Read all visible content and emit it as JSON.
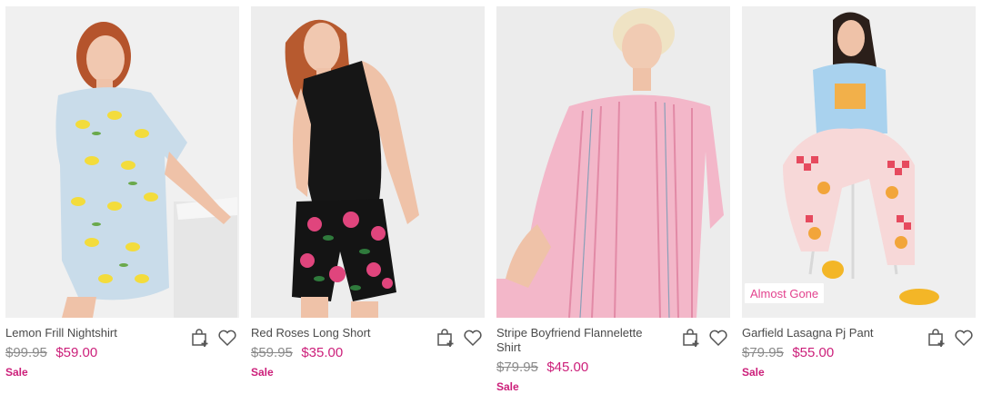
{
  "products": [
    {
      "name": "Lemon Frill Nightshirt",
      "was_price": "$99.95",
      "now_price": "$59.00",
      "tag": "Sale",
      "badge": ""
    },
    {
      "name": "Red Roses Long Short",
      "was_price": "$59.95",
      "now_price": "$35.00",
      "tag": "Sale",
      "badge": ""
    },
    {
      "name": "Stripe Boyfriend Flannelette Shirt",
      "was_price": "$79.95",
      "now_price": "$45.00",
      "tag": "Sale",
      "badge": ""
    },
    {
      "name": "Garfield Lasagna Pj Pant",
      "was_price": "$79.95",
      "now_price": "$55.00",
      "tag": "Sale",
      "badge": "Almost Gone"
    }
  ],
  "icons": {
    "add_to_bag": "bag-plus-icon",
    "wishlist": "heart-icon"
  },
  "colors": {
    "sale_price": "#cc1f7a",
    "badge_text": "#e3428e",
    "was_price": "#8a8a8a",
    "name": "#4a4a4a",
    "image_bg": "#efefef"
  }
}
